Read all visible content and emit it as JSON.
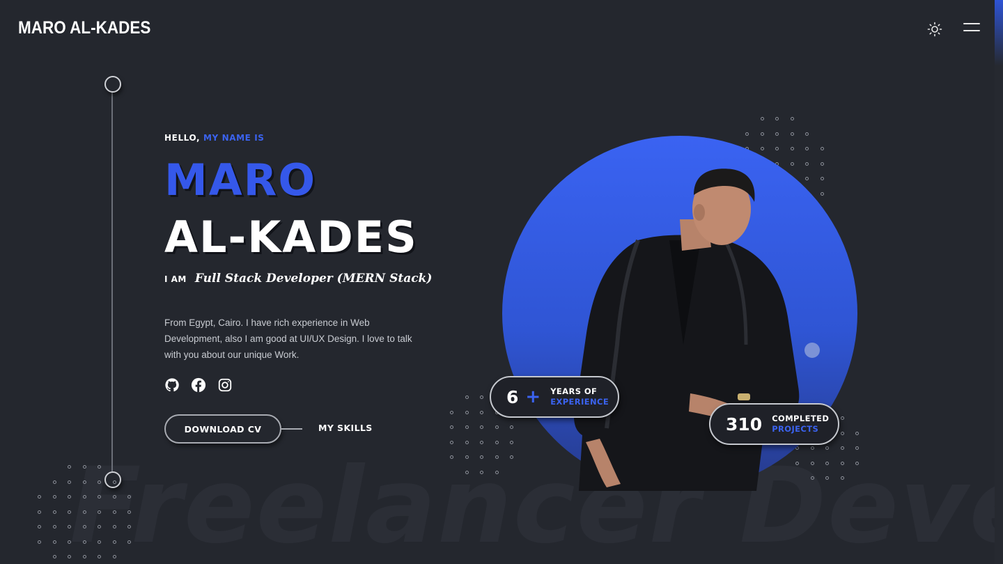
{
  "header": {
    "logo": "MARO AL-KADES",
    "theme_toggle_icon": "sun-icon",
    "menu_icon": "hamburger-menu-icon"
  },
  "hero": {
    "greeting": "HELLO,",
    "greeting_accent": "MY NAME IS",
    "first_name": "MARO",
    "last_name": "AL-KADES",
    "iam_label": "I AM",
    "role": "Full Stack Developer (MERN Stack)",
    "bio": "From Egypt, Cairo. I have rich experience in Web Development, also I am good at UI/UX Design. I love to talk with you about our unique Work.",
    "socials": [
      {
        "name": "github",
        "icon": "github-icon"
      },
      {
        "name": "facebook",
        "icon": "facebook-icon"
      },
      {
        "name": "instagram",
        "icon": "instagram-icon"
      }
    ],
    "download_cv_label": "DOWNLOAD CV",
    "skills_label": "MY SKILLS",
    "background_watermark": "Freelancer Developer"
  },
  "stats": {
    "experience": {
      "value": "6",
      "suffix": "+",
      "line1": "YEARS OF",
      "line2": "EXPERIENCE"
    },
    "projects": {
      "value": "310",
      "line1": "COMPLETED",
      "line2": "PROJECTS"
    }
  },
  "colors": {
    "background": "#24272e",
    "accent": "#3558ea",
    "text": "#ffffff"
  }
}
